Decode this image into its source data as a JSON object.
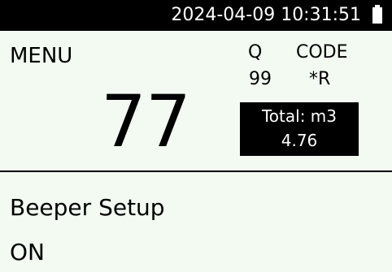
{
  "status_bar": {
    "datetime": "2024-04-09 10:31:51",
    "battery_icon": "battery-full-icon"
  },
  "header": {
    "title": "MENU"
  },
  "quality": {
    "label": "Q",
    "value": "99"
  },
  "code": {
    "label": "CODE",
    "value": "*R"
  },
  "reading": {
    "value": "77"
  },
  "total": {
    "label": "Total: m3",
    "value": "4.76"
  },
  "setting": {
    "title": "Beeper Setup",
    "value": "ON"
  },
  "colors": {
    "background": "#f2faf2",
    "foreground": "#000000",
    "inverse_text": "#ffffff"
  }
}
